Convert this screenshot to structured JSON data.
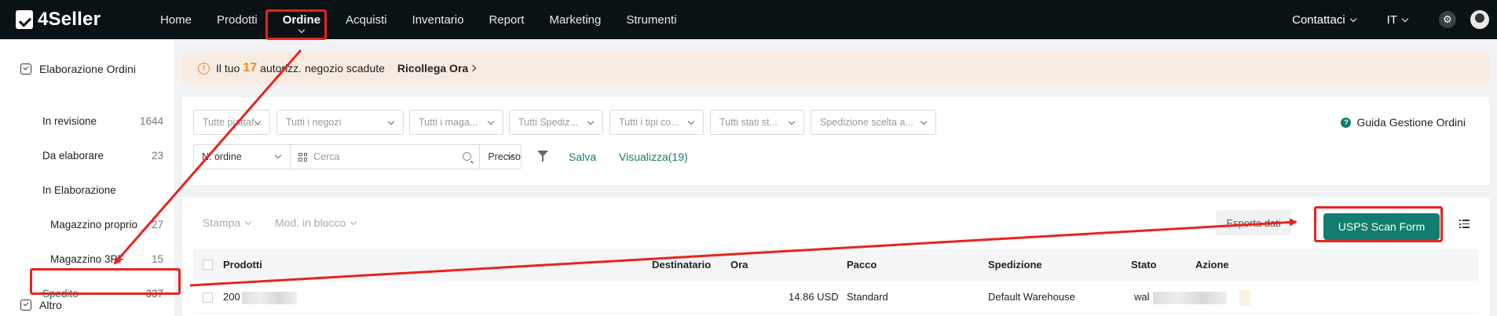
{
  "app": {
    "logo_text": "4Seller"
  },
  "nav": {
    "items": [
      "Home",
      "Prodotti",
      "Ordine",
      "Acquisti",
      "Inventario",
      "Report",
      "Marketing",
      "Strumenti"
    ],
    "active": "Ordine"
  },
  "topright": {
    "contact": "Contattaci",
    "lang": "IT",
    "icons": [
      "gear-icon",
      "avatar"
    ]
  },
  "sidebar": {
    "group1": "Elaborazione Ordini",
    "items": [
      {
        "label": "In revisione",
        "count": "1644"
      },
      {
        "label": "Da elaborare",
        "count": "23"
      },
      {
        "label": "In Elaborazione",
        "count": ""
      },
      {
        "label": "Magazzino proprio",
        "count": "27"
      },
      {
        "label": "Magazzino 3PF",
        "count": "15"
      },
      {
        "label": "Spedito",
        "count": "337"
      }
    ],
    "group2": "Altro"
  },
  "banner": {
    "prefix": "Il tuo",
    "count": "17",
    "suffix": "autorizz. negozio scadute",
    "link": "Ricollega Ora"
  },
  "filters": {
    "selects": [
      "Tutte piattaf...",
      "Tutti i negozi",
      "Tutti i maga...",
      "Tutti Spediz...",
      "Tutti i tipi co...",
      "Tutti stati st...",
      "Spedizione scelta a..."
    ],
    "guide": "Guida Gestione Ordini",
    "search_type": "N. ordine",
    "search_placeholder": "Cerca",
    "search_mode": "Preciso",
    "save": "Salva",
    "view": "Visualizza(19)"
  },
  "toolbar": {
    "print": "Stampa",
    "bulk_edit": "Mod. in blocco",
    "export": "Esporta dati",
    "usps": "USPS Scan Form"
  },
  "table": {
    "headers": [
      "Prodotti",
      "Destinatario",
      "Ora",
      "Pacco",
      "Spedizione",
      "Stato",
      "Azione"
    ],
    "row": {
      "product": "200",
      "amount": "14.86 USD",
      "package": "Standard",
      "shipping": "Default Warehouse",
      "status": "wal"
    }
  },
  "colors": {
    "accent": "#127d6f",
    "annotation": "#e8231d",
    "warning": "#f08a1c"
  }
}
